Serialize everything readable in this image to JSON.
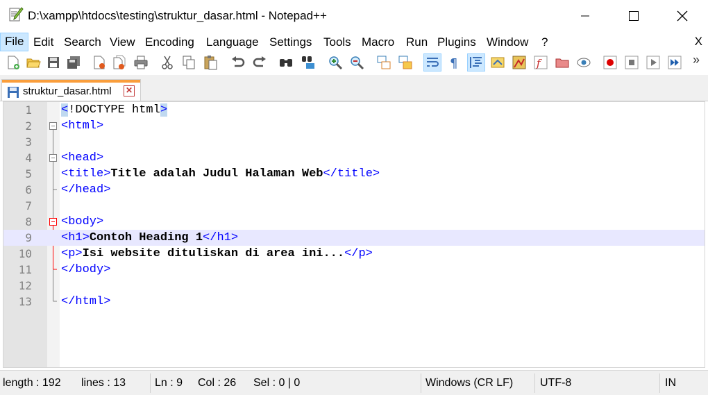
{
  "window": {
    "title": "D:\\xampp\\htdocs\\testing\\struktur_dasar.html - Notepad++",
    "minimize_glyph": "─",
    "maximize_glyph": "☐",
    "close_glyph": "✕"
  },
  "menu": {
    "items": [
      "File",
      "Edit",
      "Search",
      "View",
      "Encoding",
      "Language",
      "Settings",
      "Tools",
      "Macro",
      "Run",
      "Plugins",
      "Window",
      "?"
    ],
    "close_label": "X"
  },
  "toolbar": {
    "icons": [
      "new-file-icon",
      "open-file-icon",
      "save-icon",
      "save-all-icon",
      "close-icon",
      "close-all-icon",
      "print-icon",
      "cut-icon",
      "copy-icon",
      "paste-icon",
      "undo-icon",
      "redo-icon",
      "find-icon",
      "replace-icon",
      "zoom-in-icon",
      "zoom-out-icon",
      "sync-vertical-icon",
      "sync-horizontal-icon",
      "word-wrap-icon",
      "show-all-chars-icon",
      "indent-guide-icon",
      "udl-icon",
      "doc-map-icon",
      "function-list-icon",
      "folder-workspace-icon",
      "monitoring-icon",
      "macro-record-icon",
      "macro-stop-icon",
      "macro-play-icon",
      "macro-run-multiple-icon"
    ],
    "overflow_glyph": "»"
  },
  "tab": {
    "label": "struktur_dasar.html",
    "close_glyph": "✕"
  },
  "editor": {
    "current_line": 9,
    "lines": [
      {
        "n": "1",
        "parts": [
          {
            "t": "<",
            "c": "tag",
            "hl": true
          },
          {
            "t": "!DOCTYPE html",
            "c": "plain"
          },
          {
            "t": ">",
            "c": "tag",
            "hl": true
          }
        ]
      },
      {
        "n": "2",
        "parts": [
          {
            "t": "<html>",
            "c": "tag"
          }
        ]
      },
      {
        "n": "3",
        "parts": []
      },
      {
        "n": "4",
        "parts": [
          {
            "t": "<head>",
            "c": "tag"
          }
        ]
      },
      {
        "n": "5",
        "parts": [
          {
            "t": "<title>",
            "c": "tag"
          },
          {
            "t": "Title adalah Judul Halaman Web",
            "c": "text"
          },
          {
            "t": "</title>",
            "c": "tag"
          }
        ]
      },
      {
        "n": "6",
        "parts": [
          {
            "t": "</head>",
            "c": "tag"
          }
        ]
      },
      {
        "n": "7",
        "parts": []
      },
      {
        "n": "8",
        "parts": [
          {
            "t": "<body>",
            "c": "tag"
          }
        ]
      },
      {
        "n": "9",
        "parts": [
          {
            "t": "<h1>",
            "c": "tag"
          },
          {
            "t": "Contoh Heading 1",
            "c": "text"
          },
          {
            "t": "</h1>",
            "c": "tag"
          }
        ]
      },
      {
        "n": "10",
        "parts": [
          {
            "t": "<p>",
            "c": "tag"
          },
          {
            "t": "Isi website dituliskan di area ini...",
            "c": "text"
          },
          {
            "t": "</p>",
            "c": "tag"
          }
        ]
      },
      {
        "n": "11",
        "parts": [
          {
            "t": "</body>",
            "c": "tag"
          }
        ]
      },
      {
        "n": "12",
        "parts": []
      },
      {
        "n": "13",
        "parts": [
          {
            "t": "</html>",
            "c": "tag"
          }
        ]
      }
    ]
  },
  "status": {
    "length": "length : 192",
    "lines": "lines : 13",
    "ln": "Ln : 9",
    "col": "Col : 26",
    "sel": "Sel : 0 | 0",
    "eol": "Windows (CR LF)",
    "encoding": "UTF-8",
    "mode": "IN"
  },
  "colors": {
    "tag": "#0000ff",
    "tab_accent": "#fa9e3c",
    "current_line": "#e8e8ff",
    "fold_red": "#ff0000"
  }
}
